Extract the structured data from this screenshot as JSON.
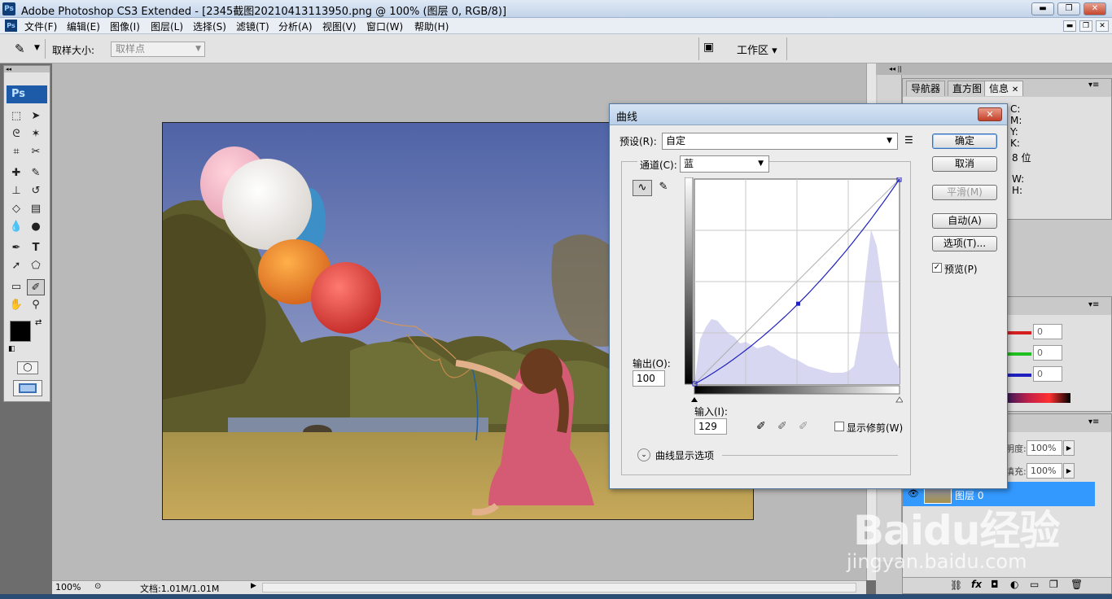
{
  "app": {
    "logo": "Ps",
    "title": "Adobe Photoshop CS3 Extended - [2345截图20210413113950.png @ 100% (图层 0, RGB/8)]"
  },
  "menu": [
    "文件(F)",
    "编辑(E)",
    "图像(I)",
    "图层(L)",
    "选择(S)",
    "滤镜(T)",
    "分析(A)",
    "视图(V)",
    "窗口(W)",
    "帮助(H)"
  ],
  "options_bar": {
    "sample_size_label": "取样大小:",
    "sample_size_value": "取样点",
    "workspace_label": "工作区 ▾"
  },
  "toolbox": {
    "logo": "Ps"
  },
  "status_bar": {
    "zoom": "100%",
    "doc_info": "文档:1.01M/1.01M"
  },
  "panels": {
    "info_tabs": [
      "导航器",
      "直方图",
      "信息"
    ],
    "info_cmyk": [
      "C:",
      "M:",
      "Y:",
      "K:"
    ],
    "info_bits": "8 位",
    "info_wh": [
      "W:",
      "H:"
    ],
    "color_values": [
      "0",
      "0",
      "0"
    ],
    "layers_opacity_label": "明度:",
    "layers_opacity_value": "100%",
    "layers_fill_label": "填充:",
    "layers_fill_value": "100%",
    "layer_name": "图层 0"
  },
  "dialog": {
    "title": "曲线",
    "preset_label": "预设(R):",
    "preset_value": "自定",
    "channel_label": "通道(C):",
    "channel_value": "蓝",
    "output_label": "输出(O):",
    "output_value": "100",
    "input_label": "输入(I):",
    "input_value": "129",
    "show_clipping_label": "显示修剪(W)",
    "curve_display_options": "曲线显示选项",
    "buttons": {
      "ok": "确定",
      "cancel": "取消",
      "smooth": "平滑(M)",
      "auto": "自动(A)",
      "options": "选项(T)...",
      "preview": "预览(P)"
    },
    "preview_checked": true,
    "curve_point": {
      "input": 129,
      "output": 100
    }
  },
  "watermark": {
    "brand": "Baidu经验",
    "url": "jingyan.baidu.com"
  },
  "colors": {
    "histogram_fill": "#d7d7f2",
    "curve_line": "#2020c0",
    "highlight_blue": "#3399ff"
  }
}
